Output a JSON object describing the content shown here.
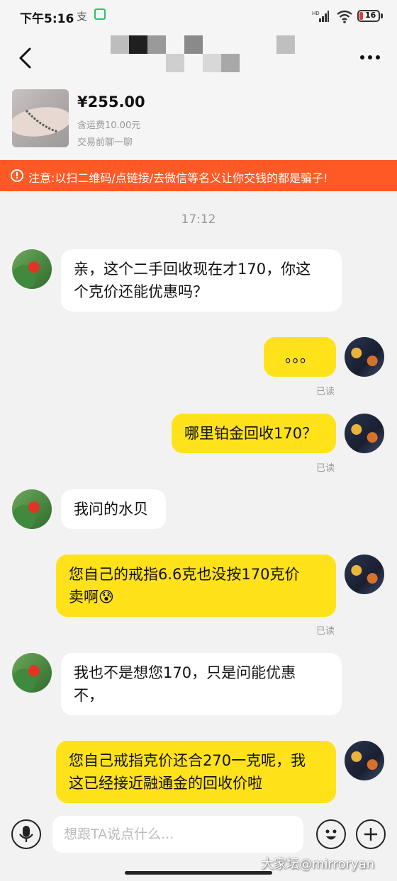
{
  "status_bar": {
    "time": "下午5:16",
    "app_glyph": "支",
    "battery": "16",
    "network_type": "HD",
    "icons": [
      "alipay-icon",
      "wechat-pay-icon",
      "signal-icon",
      "wifi-icon",
      "battery-icon"
    ]
  },
  "nav": {
    "back_icon": "chevron-left-icon",
    "more_icon": "more-dots-icon"
  },
  "product": {
    "price": "¥255.00",
    "shipping": "含运费10.00元",
    "chat_prompt": "交易前聊一聊"
  },
  "warning": {
    "icon": "!",
    "text": "注意:以扫二维码/点链接/去微信等名义让你交钱的都是骗子!"
  },
  "chat": {
    "time_divider": "17:12",
    "messages": [
      {
        "side": "in",
        "lines": [
          "亲，这个二手回收现在才170，你这",
          "个克价还能优惠吗？"
        ]
      },
      {
        "side": "out",
        "lines": [
          "。。。"
        ],
        "status": "已读"
      },
      {
        "side": "out",
        "lines": [
          "哪里铂金回收170？"
        ],
        "status": "已读"
      },
      {
        "side": "in",
        "lines": [
          "我问的水贝"
        ]
      },
      {
        "side": "out",
        "lines": [
          "您自己的戒指6.6克也没按170克价",
          "卖啊😰"
        ],
        "status": "已读"
      },
      {
        "side": "in",
        "lines": [
          "我也不是想您170，只是问能优惠",
          "不，"
        ]
      },
      {
        "side": "out",
        "lines": [
          "您自己戒指克价还合270一克呢，我",
          "这已经接近融通金的回收价啦"
        ]
      }
    ]
  },
  "input": {
    "placeholder": "想跟TA说点什么..."
  },
  "watermark": "大家坛@mirroryan",
  "colors": {
    "accent_yellow": "#ffe21a",
    "warning_orange": "#ff5a26",
    "background": "#f2f2f2"
  }
}
